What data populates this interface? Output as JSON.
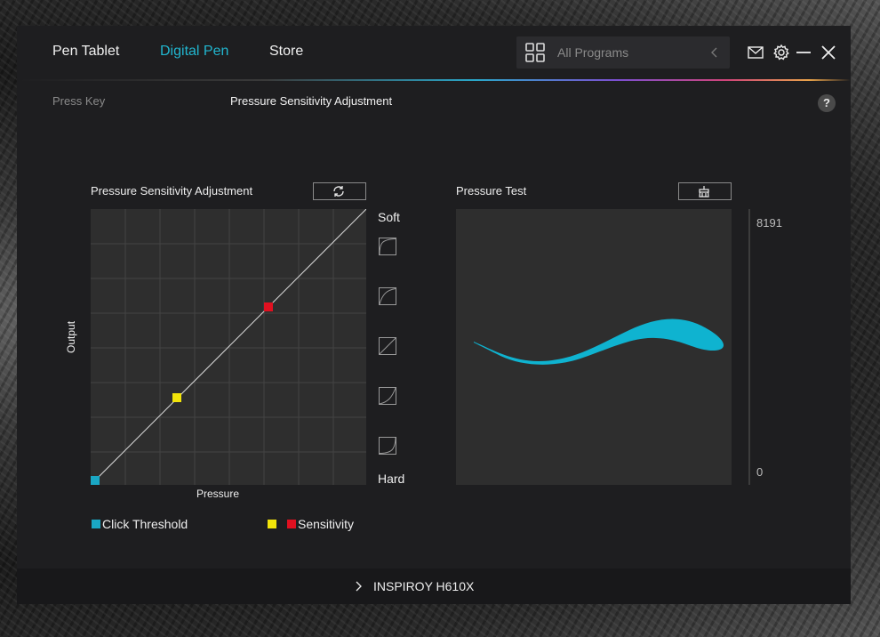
{
  "nav": {
    "tabs": [
      {
        "label": "Pen Tablet"
      },
      {
        "label": "Digital Pen",
        "active": true
      },
      {
        "label": "Store"
      }
    ]
  },
  "search": {
    "placeholder": "All Programs"
  },
  "subtabs": [
    {
      "label": "Press Key"
    },
    {
      "label": "Pressure Sensitivity Adjustment",
      "active": true
    }
  ],
  "help_label": "?",
  "pressure_panel": {
    "title": "Pressure Sensitivity Adjustment",
    "soft_label": "Soft",
    "hard_label": "Hard",
    "x_label": "Pressure",
    "y_label": "Output",
    "curve_presets": [
      "soft-curve-1-icon",
      "soft-curve-2-icon",
      "linear-curve-icon",
      "hard-curve-1-icon",
      "hard-curve-2-icon"
    ]
  },
  "pressure_test": {
    "title": "Pressure Test",
    "max_label": "8191",
    "min_label": "0"
  },
  "legend": {
    "click_threshold": "Click Threshold",
    "sensitivity": "Sensitivity"
  },
  "footer": {
    "device": "INSPIROY H610X"
  },
  "colors": {
    "accent": "#21b6cf",
    "threshold": "#1aa7c4",
    "sensitivity_low": "#f2e40a",
    "sensitivity_high": "#e01020",
    "stroke": "#0fb3d0"
  }
}
